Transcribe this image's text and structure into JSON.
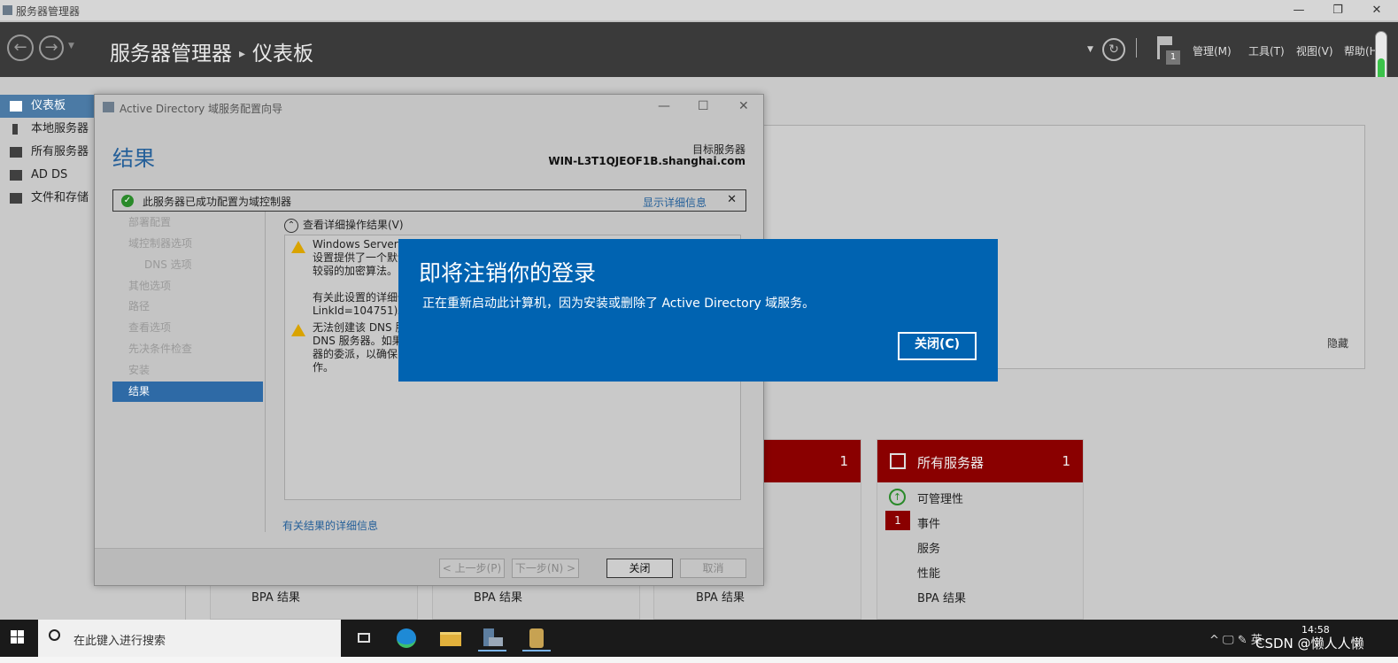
{
  "window": {
    "title": "服务器管理器",
    "minimize": "—",
    "restore": "❐",
    "close": "✕"
  },
  "header": {
    "app": "服务器管理器",
    "separator": "▸",
    "page": "仪表板",
    "flag_count": "1",
    "menus": [
      "管理(M)",
      "工具(T)",
      "视图(V)",
      "帮助(H)"
    ]
  },
  "sidebar": {
    "items": [
      {
        "label": "仪表板",
        "selected": true
      },
      {
        "label": "本地服务器",
        "selected": false
      },
      {
        "label": "所有服务器",
        "selected": false
      },
      {
        "label": "AD DS",
        "selected": false
      },
      {
        "label": "文件和存储",
        "selected": false
      }
    ]
  },
  "dashboard": {
    "hide_label": "隐藏",
    "tile_left": {
      "count": "1"
    },
    "tile_all": {
      "title": "所有服务器",
      "count": "1",
      "rows": [
        "可管理性",
        "事件",
        "服务",
        "性能",
        "BPA 结果"
      ],
      "event_badge": "1"
    },
    "bpa_labels": [
      "BPA 结果",
      "BPA 结果",
      "BPA 结果"
    ]
  },
  "wizard": {
    "title": "Active Directory 域服务配置向导",
    "heading": "结果",
    "target_label": "目标服务器",
    "target_value": "WIN-L3T1QJEOF1B.shanghai.com",
    "success_message": "此服务器已成功配置为域控制器",
    "show_details": "显示详细信息",
    "steps": [
      "部署配置",
      "域控制器选项",
      "DNS 选项",
      "其他选项",
      "路径",
      "查看选项",
      "先决条件检查",
      "安装",
      "结果"
    ],
    "view_results": "查看详细操作结果(V)",
    "result1": "Windows Server\n设置提供了一个默认\n较弱的加密算法。\n\n有关此设置的详细信\nLinkId=104751)。",
    "result2": "无法创建该 DNS 服\nDNS 服务器。如果\n器的委派，以确保\n作。",
    "more_info": "有关结果的详细信息",
    "buttons": {
      "prev": "< 上一步(P)",
      "next": "下一步(N) >",
      "close": "关闭",
      "cancel": "取消"
    }
  },
  "logoff": {
    "title": "即将注销你的登录",
    "message": "正在重新启动此计算机，因为安装或删除了 Active Directory 域服务。",
    "close_button": "关闭(C)"
  },
  "taskbar": {
    "search_placeholder": "在此键入进行搜索",
    "time": "14:58",
    "watermark": "CSDN @懒人人懒",
    "tray": "^ 🖵 ✎ 英"
  },
  "colors": {
    "logoff_blue": "#0063b1",
    "tile_red": "#8a0000",
    "selection_blue": "#2e6aa6"
  }
}
